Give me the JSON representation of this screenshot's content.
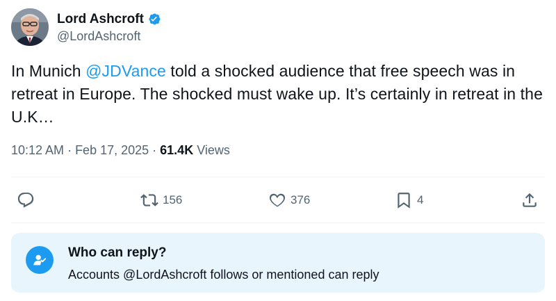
{
  "author": {
    "display_name": "Lord Ashcroft",
    "handle": "@LordAshcroft",
    "verified": true
  },
  "tweet": {
    "text_before": "In Munich ",
    "mention": "@JDVance",
    "text_after": " told a shocked audience that free speech was in retreat in Europe. The shocked must wake up. It’s certainly in retreat in the U.K…"
  },
  "meta": {
    "time": "10:12 AM",
    "separator": " · ",
    "date": "Feb 17, 2025",
    "views_count": "61.4K",
    "views_label": " Views"
  },
  "actions": {
    "reply_icon": "reply-icon",
    "retweet_icon": "retweet-icon",
    "retweet_count": "156",
    "like_icon": "heart-icon",
    "like_count": "376",
    "bookmark_icon": "bookmark-icon",
    "bookmark_count": "4",
    "share_icon": "share-icon"
  },
  "reply_restriction": {
    "icon": "user-check-icon",
    "title": "Who can reply?",
    "description": "Accounts @LordAshcroft follows or mentioned can reply"
  },
  "colors": {
    "accent": "#1d9bf0",
    "text": "#0f1419",
    "secondary": "#536471",
    "reply_box_bg": "#e8f5fd"
  }
}
